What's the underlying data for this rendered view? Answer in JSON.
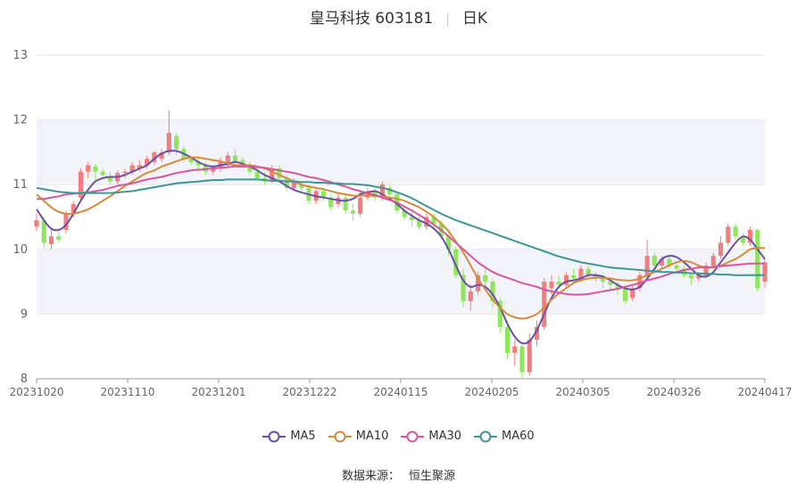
{
  "title": {
    "name": "皇马科技 603181",
    "period": "日K"
  },
  "source": {
    "label": "数据来源：",
    "provider": "恒生聚源"
  },
  "colors": {
    "up": "#f47c7c",
    "down": "#8ee65a",
    "MA5": "#6a4fa8",
    "MA10": "#d68a3c",
    "MA30": "#d9559e",
    "MA60": "#3d9595",
    "band": "#f3f4f9",
    "grid": "#e6e6e6"
  },
  "chart_data": {
    "type": "candlestick",
    "ylim": [
      8,
      13
    ],
    "yticks": [
      "8",
      "9",
      "10",
      "11",
      "12",
      "13"
    ],
    "xticks": [
      "20231020",
      "20231110",
      "20231201",
      "20231222",
      "20240115",
      "20240205",
      "20240305",
      "20240326",
      "20240417"
    ],
    "grid": true,
    "legend_position": "bottom",
    "legend": [
      "MA5",
      "MA10",
      "MA30",
      "MA60"
    ],
    "candles": [
      [
        10.35,
        10.45,
        10.55,
        10.28
      ],
      [
        10.45,
        10.1,
        10.5,
        10.02
      ],
      [
        10.08,
        10.2,
        10.3,
        10.0
      ],
      [
        10.2,
        10.15,
        10.28,
        10.1
      ],
      [
        10.3,
        10.55,
        10.6,
        10.25
      ],
      [
        10.55,
        10.7,
        10.75,
        10.5
      ],
      [
        10.8,
        11.2,
        11.25,
        10.75
      ],
      [
        11.2,
        11.3,
        11.35,
        11.1
      ],
      [
        11.28,
        11.2,
        11.32,
        11.05
      ],
      [
        11.2,
        11.15,
        11.25,
        11.08
      ],
      [
        11.12,
        11.05,
        11.2,
        11.0
      ],
      [
        11.05,
        11.18,
        11.22,
        11.0
      ],
      [
        11.18,
        11.2,
        11.25,
        11.1
      ],
      [
        11.2,
        11.3,
        11.35,
        11.15
      ],
      [
        11.25,
        11.3,
        11.38,
        11.2
      ],
      [
        11.3,
        11.4,
        11.45,
        11.25
      ],
      [
        11.35,
        11.5,
        11.52,
        11.3
      ],
      [
        11.4,
        11.5,
        11.55,
        11.35
      ],
      [
        11.5,
        11.8,
        12.15,
        11.45
      ],
      [
        11.75,
        11.55,
        11.8,
        11.45
      ],
      [
        11.55,
        11.4,
        11.6,
        11.35
      ],
      [
        11.4,
        11.35,
        11.45,
        11.3
      ],
      [
        11.35,
        11.3,
        11.4,
        11.2
      ],
      [
        11.3,
        11.2,
        11.35,
        11.15
      ],
      [
        11.2,
        11.25,
        11.3,
        11.15
      ],
      [
        11.25,
        11.35,
        11.42,
        11.2
      ],
      [
        11.3,
        11.45,
        11.5,
        11.28
      ],
      [
        11.45,
        11.35,
        11.55,
        11.3
      ],
      [
        11.38,
        11.3,
        11.42,
        11.25
      ],
      [
        11.3,
        11.2,
        11.35,
        11.15
      ],
      [
        11.2,
        11.1,
        11.25,
        11.05
      ],
      [
        11.1,
        11.05,
        11.2,
        11.0
      ],
      [
        11.05,
        11.25,
        11.3,
        11.02
      ],
      [
        11.25,
        11.1,
        11.3,
        11.05
      ],
      [
        11.1,
        10.95,
        11.15,
        10.9
      ],
      [
        10.95,
        11.05,
        11.1,
        10.92
      ],
      [
        11.0,
        10.95,
        11.05,
        10.9
      ],
      [
        10.95,
        10.75,
        11.0,
        10.7
      ],
      [
        10.75,
        10.9,
        10.95,
        10.7
      ],
      [
        10.9,
        10.8,
        10.95,
        10.75
      ],
      [
        10.8,
        10.65,
        10.85,
        10.6
      ],
      [
        10.7,
        10.8,
        10.88,
        10.65
      ],
      [
        10.8,
        10.6,
        10.85,
        10.55
      ],
      [
        10.6,
        10.55,
        10.7,
        10.45
      ],
      [
        10.55,
        10.8,
        10.9,
        10.5
      ],
      [
        10.8,
        10.9,
        10.95,
        10.75
      ],
      [
        10.9,
        10.8,
        10.95,
        10.75
      ],
      [
        10.8,
        11.0,
        11.05,
        10.75
      ],
      [
        10.95,
        10.85,
        11.0,
        10.8
      ],
      [
        10.85,
        10.6,
        10.9,
        10.55
      ],
      [
        10.6,
        10.5,
        10.7,
        10.45
      ],
      [
        10.5,
        10.45,
        10.6,
        10.35
      ],
      [
        10.45,
        10.35,
        10.55,
        10.3
      ],
      [
        10.35,
        10.5,
        10.55,
        10.3
      ],
      [
        10.5,
        10.4,
        10.55,
        10.3
      ],
      [
        10.4,
        10.2,
        10.45,
        10.15
      ],
      [
        10.2,
        10.0,
        10.25,
        9.9
      ],
      [
        10.0,
        9.6,
        10.05,
        9.55
      ],
      [
        9.6,
        9.2,
        9.7,
        9.1
      ],
      [
        9.2,
        9.35,
        9.45,
        9.05
      ],
      [
        9.35,
        9.6,
        9.65,
        9.3
      ],
      [
        9.6,
        9.5,
        9.7,
        9.4
      ],
      [
        9.5,
        9.2,
        9.55,
        9.1
      ],
      [
        9.2,
        8.8,
        9.25,
        8.7
      ],
      [
        8.8,
        8.4,
        8.9,
        8.3
      ],
      [
        8.4,
        8.5,
        8.6,
        8.2
      ],
      [
        8.5,
        8.1,
        8.55,
        8.0
      ],
      [
        8.1,
        8.6,
        8.7,
        8.05
      ],
      [
        8.6,
        8.8,
        8.9,
        8.5
      ],
      [
        8.8,
        9.5,
        9.55,
        8.75
      ],
      [
        9.4,
        9.5,
        9.6,
        9.3
      ],
      [
        9.5,
        9.45,
        9.6,
        9.4
      ],
      [
        9.45,
        9.6,
        9.65,
        9.4
      ],
      [
        9.6,
        9.55,
        9.7,
        9.45
      ],
      [
        9.55,
        9.7,
        9.75,
        9.5
      ],
      [
        9.7,
        9.6,
        9.75,
        9.55
      ],
      [
        9.6,
        9.55,
        9.65,
        9.5
      ],
      [
        9.55,
        9.5,
        9.6,
        9.4
      ],
      [
        9.5,
        9.45,
        9.55,
        9.35
      ],
      [
        9.45,
        9.4,
        9.5,
        9.3
      ],
      [
        9.4,
        9.2,
        9.45,
        9.15
      ],
      [
        9.25,
        9.4,
        9.45,
        9.2
      ],
      [
        9.4,
        9.6,
        9.65,
        9.35
      ],
      [
        9.6,
        9.9,
        10.15,
        9.55
      ],
      [
        9.9,
        9.75,
        9.95,
        9.7
      ],
      [
        9.75,
        9.85,
        9.9,
        9.7
      ],
      [
        9.85,
        9.75,
        9.9,
        9.7
      ],
      [
        9.75,
        9.7,
        9.8,
        9.65
      ],
      [
        9.7,
        9.6,
        9.75,
        9.55
      ],
      [
        9.6,
        9.55,
        9.65,
        9.45
      ],
      [
        9.55,
        9.6,
        9.65,
        9.5
      ],
      [
        9.6,
        9.75,
        9.8,
        9.55
      ],
      [
        9.75,
        9.9,
        9.95,
        9.7
      ],
      [
        9.9,
        10.1,
        10.2,
        9.85
      ],
      [
        10.1,
        10.35,
        10.4,
        10.05
      ],
      [
        10.35,
        10.2,
        10.4,
        10.15
      ],
      [
        10.2,
        10.1,
        10.25,
        10.05
      ],
      [
        10.1,
        10.3,
        10.35,
        10.05
      ],
      [
        10.3,
        9.4,
        10.32,
        9.35
      ],
      [
        9.5,
        9.8,
        9.85,
        9.4
      ]
    ],
    "series": [
      {
        "name": "MA5",
        "values": [
          10.62,
          10.45,
          10.32,
          10.3,
          10.38,
          10.55,
          10.75,
          10.92,
          11.05,
          11.1,
          11.12,
          11.12,
          11.15,
          11.2,
          11.25,
          11.3,
          11.4,
          11.48,
          11.52,
          11.52,
          11.48,
          11.42,
          11.35,
          11.3,
          11.28,
          11.3,
          11.32,
          11.35,
          11.32,
          11.28,
          11.22,
          11.15,
          11.1,
          11.05,
          10.98,
          10.92,
          10.88,
          10.85,
          10.82,
          10.8,
          10.78,
          10.76,
          10.75,
          10.78,
          10.85,
          10.88,
          10.9,
          10.85,
          10.78,
          10.7,
          10.6,
          10.52,
          10.45,
          10.4,
          10.32,
          10.2,
          10.0,
          9.75,
          9.52,
          9.42,
          9.45,
          9.42,
          9.3,
          9.1,
          8.85,
          8.65,
          8.55,
          8.58,
          8.75,
          9.0,
          9.25,
          9.42,
          9.5,
          9.52,
          9.55,
          9.6,
          9.6,
          9.58,
          9.52,
          9.45,
          9.4,
          9.38,
          9.42,
          9.55,
          9.7,
          9.85,
          9.9,
          9.88,
          9.8,
          9.7,
          9.6,
          9.58,
          9.65,
          9.8,
          9.95,
          10.1,
          10.2,
          10.15,
          10.0,
          9.85
        ]
      },
      {
        "name": "MA10",
        "values": [
          10.85,
          10.75,
          10.65,
          10.58,
          10.55,
          10.55,
          10.58,
          10.62,
          10.68,
          10.75,
          10.82,
          10.9,
          10.98,
          11.05,
          11.12,
          11.18,
          11.22,
          11.28,
          11.32,
          11.36,
          11.4,
          11.42,
          11.42,
          11.4,
          11.38,
          11.36,
          11.33,
          11.3,
          11.3,
          11.3,
          11.28,
          11.25,
          11.2,
          11.15,
          11.1,
          11.05,
          11.0,
          10.97,
          10.95,
          10.93,
          10.9,
          10.87,
          10.85,
          10.83,
          10.83,
          10.83,
          10.83,
          10.82,
          10.8,
          10.78,
          10.75,
          10.7,
          10.65,
          10.58,
          10.5,
          10.4,
          10.28,
          10.12,
          9.95,
          9.75,
          9.55,
          9.38,
          9.22,
          9.1,
          9.0,
          8.95,
          8.93,
          8.95,
          9.0,
          9.1,
          9.22,
          9.32,
          9.4,
          9.48,
          9.52,
          9.55,
          9.56,
          9.56,
          9.55,
          9.53,
          9.52,
          9.52,
          9.55,
          9.6,
          9.65,
          9.7,
          9.75,
          9.8,
          9.82,
          9.8,
          9.75,
          9.72,
          9.72,
          9.75,
          9.8,
          9.85,
          9.92,
          10.0,
          10.02,
          10.02
        ]
      },
      {
        "name": "MA30",
        "values": [
          10.78,
          10.78,
          10.8,
          10.82,
          10.85,
          10.86,
          10.87,
          10.88,
          10.9,
          10.92,
          10.95,
          10.98,
          11.0,
          11.02,
          11.05,
          11.08,
          11.1,
          11.12,
          11.15,
          11.18,
          11.2,
          11.22,
          11.23,
          11.24,
          11.25,
          11.26,
          11.27,
          11.28,
          11.28,
          11.28,
          11.27,
          11.26,
          11.24,
          11.22,
          11.2,
          11.18,
          11.15,
          11.12,
          11.1,
          11.07,
          11.04,
          11.0,
          10.97,
          10.93,
          10.9,
          10.87,
          10.84,
          10.8,
          10.76,
          10.72,
          10.66,
          10.6,
          10.53,
          10.46,
          10.38,
          10.3,
          10.2,
          10.1,
          10.0,
          9.9,
          9.8,
          9.72,
          9.65,
          9.6,
          9.56,
          9.52,
          9.48,
          9.45,
          9.42,
          9.38,
          9.35,
          9.33,
          9.31,
          9.3,
          9.3,
          9.31,
          9.33,
          9.35,
          9.37,
          9.39,
          9.42,
          9.45,
          9.48,
          9.52,
          9.55,
          9.58,
          9.62,
          9.65,
          9.68,
          9.7,
          9.72,
          9.72,
          9.73,
          9.74,
          9.75,
          9.76,
          9.77,
          9.78,
          9.78,
          9.78
        ]
      },
      {
        "name": "MA60",
        "values": [
          10.95,
          10.93,
          10.91,
          10.89,
          10.88,
          10.87,
          10.87,
          10.87,
          10.87,
          10.87,
          10.87,
          10.88,
          10.89,
          10.9,
          10.92,
          10.94,
          10.96,
          10.98,
          11.0,
          11.02,
          11.03,
          11.04,
          11.05,
          11.06,
          11.07,
          11.07,
          11.08,
          11.08,
          11.08,
          11.08,
          11.08,
          11.07,
          11.06,
          11.06,
          11.05,
          11.05,
          11.04,
          11.04,
          11.03,
          11.03,
          11.02,
          11.02,
          11.01,
          11.01,
          11.0,
          10.99,
          10.97,
          10.95,
          10.92,
          10.88,
          10.84,
          10.79,
          10.73,
          10.67,
          10.61,
          10.55,
          10.5,
          10.45,
          10.41,
          10.37,
          10.33,
          10.29,
          10.25,
          10.21,
          10.17,
          10.13,
          10.09,
          10.05,
          10.01,
          9.97,
          9.93,
          9.89,
          9.86,
          9.83,
          9.8,
          9.78,
          9.76,
          9.74,
          9.72,
          9.71,
          9.7,
          9.69,
          9.68,
          9.67,
          9.66,
          9.65,
          9.65,
          9.64,
          9.64,
          9.63,
          9.63,
          9.62,
          9.62,
          9.61,
          9.61,
          9.6,
          9.6,
          9.6,
          9.6,
          9.6
        ]
      }
    ]
  }
}
